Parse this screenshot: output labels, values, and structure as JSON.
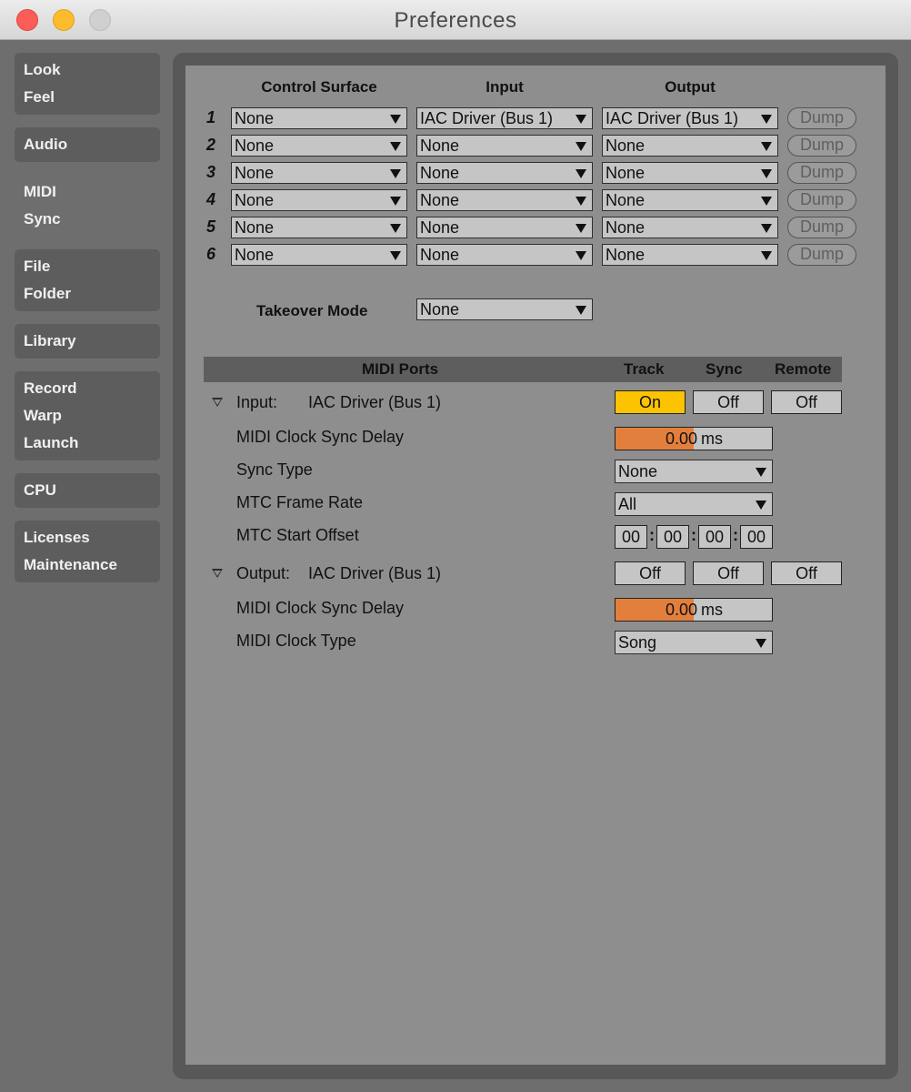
{
  "window": {
    "title": "Preferences"
  },
  "sidebar": {
    "tabs": [
      {
        "id": "look-feel",
        "lines": [
          "Look",
          "Feel"
        ]
      },
      {
        "id": "audio",
        "lines": [
          "Audio"
        ]
      },
      {
        "id": "midi-sync",
        "lines": [
          "MIDI",
          "Sync"
        ],
        "active": true
      },
      {
        "id": "file-folder",
        "lines": [
          "File",
          "Folder"
        ]
      },
      {
        "id": "library",
        "lines": [
          "Library"
        ]
      },
      {
        "id": "record-warp-launch",
        "lines": [
          "Record",
          "Warp",
          "Launch"
        ]
      },
      {
        "id": "cpu",
        "lines": [
          "CPU"
        ]
      },
      {
        "id": "licenses-maintenance",
        "lines": [
          "Licenses",
          "Maintenance"
        ]
      }
    ]
  },
  "control_surfaces": {
    "headers": {
      "control_surface": "Control Surface",
      "input": "Input",
      "output": "Output"
    },
    "dump_label": "Dump",
    "rows": [
      {
        "num": "1",
        "surface": "None",
        "input": "IAC Driver (Bus 1)",
        "output": "IAC Driver (Bus 1)"
      },
      {
        "num": "2",
        "surface": "None",
        "input": "None",
        "output": "None"
      },
      {
        "num": "3",
        "surface": "None",
        "input": "None",
        "output": "None"
      },
      {
        "num": "4",
        "surface": "None",
        "input": "None",
        "output": "None"
      },
      {
        "num": "5",
        "surface": "None",
        "input": "None",
        "output": "None"
      },
      {
        "num": "6",
        "surface": "None",
        "input": "None",
        "output": "None"
      }
    ]
  },
  "takeover": {
    "label": "Takeover Mode",
    "value": "None"
  },
  "midi_ports": {
    "headers": {
      "ports": "MIDI Ports",
      "track": "Track",
      "sync": "Sync",
      "remote": "Remote"
    },
    "input": {
      "kind": "Input:",
      "device": "IAC Driver (Bus 1)",
      "track": "On",
      "sync": "Off",
      "remote": "Off",
      "clock_delay": {
        "label": "MIDI Clock Sync Delay",
        "value": "0.00",
        "unit": "ms"
      },
      "sync_type": {
        "label": "Sync Type",
        "value": "None"
      },
      "mtc_frame_rate": {
        "label": "MTC Frame Rate",
        "value": "All"
      },
      "mtc_start_offset": {
        "label": "MTC Start Offset",
        "values": [
          "00",
          "00",
          "00",
          "00"
        ],
        "sep": ":"
      }
    },
    "output": {
      "kind": "Output:",
      "device": "IAC Driver (Bus 1)",
      "track": "Off",
      "sync": "Off",
      "remote": "Off",
      "clock_delay": {
        "label": "MIDI Clock Sync Delay",
        "value": "0.00",
        "unit": "ms"
      },
      "clock_type": {
        "label": "MIDI Clock Type",
        "value": "Song"
      }
    }
  },
  "colors": {
    "on_toggle": "#fcc400",
    "delay_fill": "#e37f3d",
    "panel_bg": "#8e8e8e"
  }
}
